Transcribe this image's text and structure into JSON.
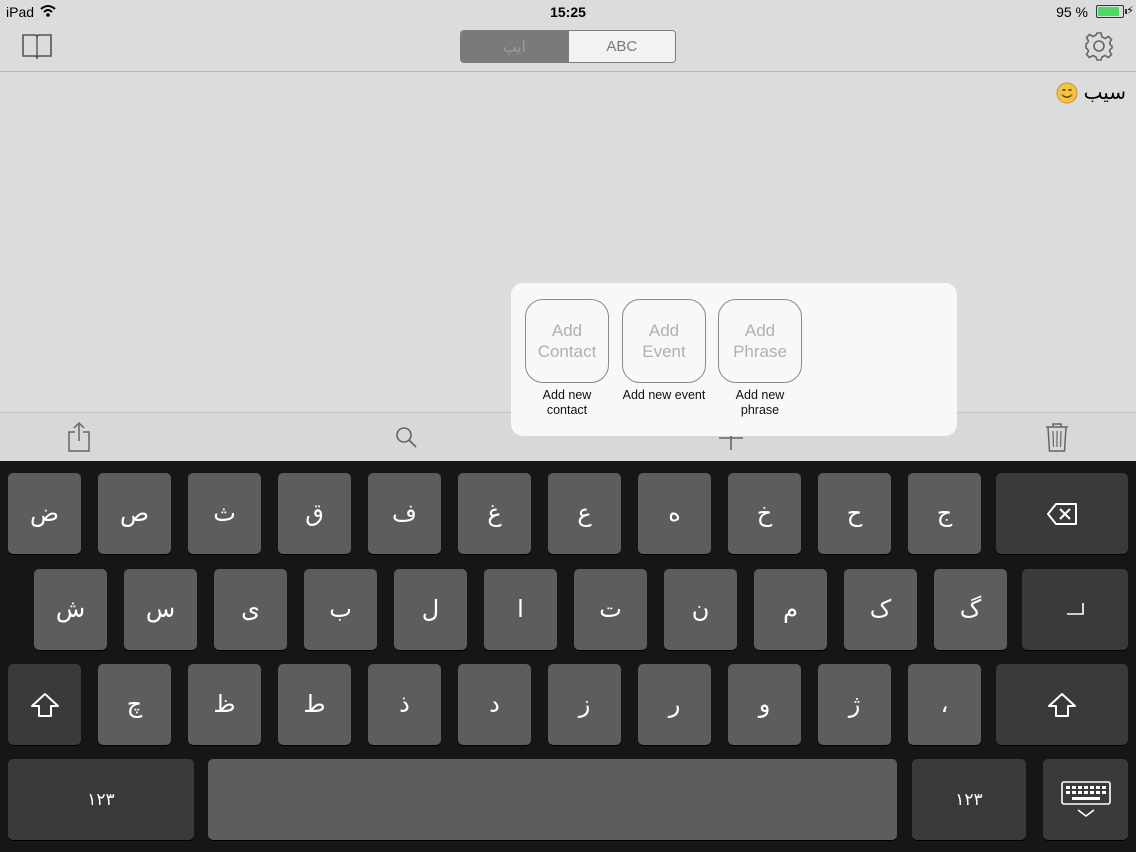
{
  "status_bar": {
    "carrier": "iPad",
    "time": "15:25",
    "battery_percent": "95 %",
    "battery_level": 0.95
  },
  "nav": {
    "segments": [
      {
        "label": "ایپ",
        "selected": true
      },
      {
        "label": "ABC",
        "selected": false
      }
    ],
    "left_icon": "book-icon",
    "right_icon": "gear-icon"
  },
  "document": {
    "text": "سیب",
    "emoji": "smiling-face-icon"
  },
  "popover": {
    "items": [
      {
        "line1": "Add",
        "line2": "Contact",
        "caption": "Add new contact"
      },
      {
        "line1": "Add",
        "line2": "Event",
        "caption": "Add new event"
      },
      {
        "line1": "Add",
        "line2": "Phrase",
        "caption": "Add new phrase"
      }
    ]
  },
  "toolbar": {
    "icons": [
      "share-icon",
      "search-icon",
      "plus-icon",
      "trash-icon"
    ]
  },
  "keyboard": {
    "row1": [
      "ض",
      "ص",
      "ث",
      "ق",
      "ف",
      "غ",
      "ع",
      "ه",
      "خ",
      "ح",
      "ج"
    ],
    "row2": [
      "ش",
      "س",
      "ی",
      "ب",
      "ل",
      "ا",
      "ت",
      "ن",
      "م",
      "ک",
      "گ"
    ],
    "row3": [
      "چ",
      "ظ",
      "ط",
      "ز",
      "ر",
      "ذ",
      "د",
      "و",
      "ژ",
      "،"
    ],
    "numbers_label": "۱۲۳"
  },
  "colors": {
    "keyboard_bg": "#161616",
    "key": "#5d5d5f",
    "key_dark": "#3a3a3c",
    "battery": "#4cd964",
    "content_bg": "#dcdbdd"
  }
}
